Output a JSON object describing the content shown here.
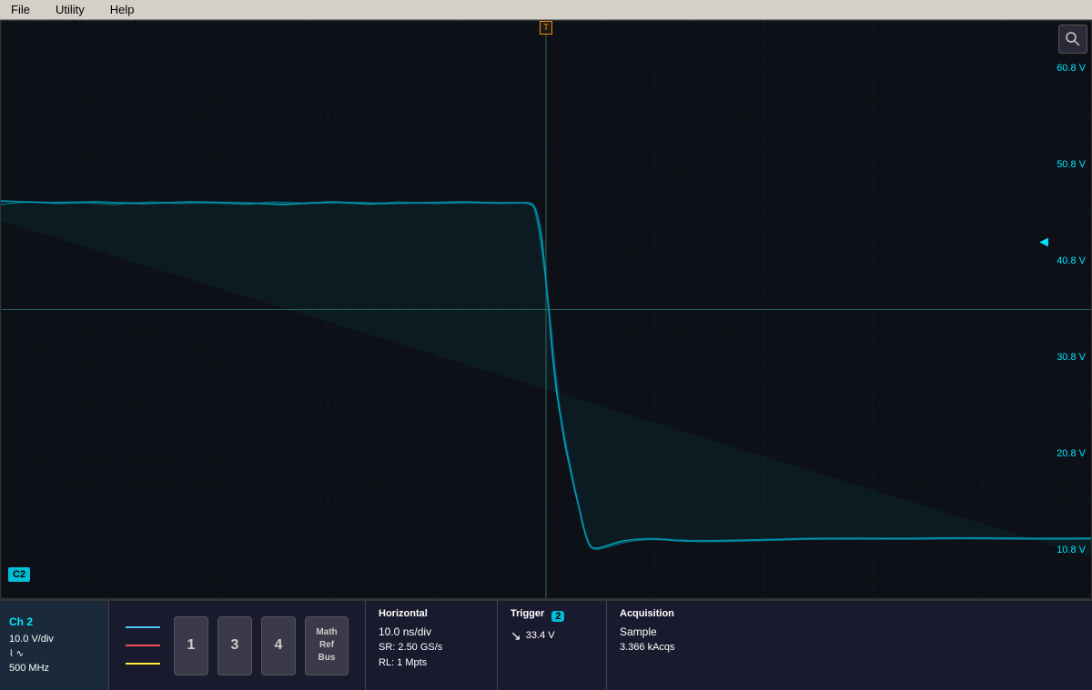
{
  "menubar": {
    "items": [
      "File",
      "Utility",
      "Help"
    ]
  },
  "yaxis": {
    "labels": [
      "60.8 V",
      "50.8 V",
      "40.8 V",
      "30.8 V",
      "20.8 V",
      "10.8 V"
    ]
  },
  "channel": {
    "ch2_label": "C2",
    "ch2_title": "Ch 2",
    "ch2_vdiv": "10.0 V/div",
    "ch2_bw": "500 MHz",
    "ch2_icon": "⌇"
  },
  "channel_buttons": {
    "btn1": "1",
    "btn3": "3",
    "btn4": "4",
    "math_label": "Math\nRef\nBus"
  },
  "waveform_lines": {
    "ch1_color": "#4fc3f7",
    "ch2_color": "#ef5350",
    "ch3_color": "#ffeb3b",
    "ch_inactive": "#555"
  },
  "horizontal": {
    "title": "Horizontal",
    "time_div": "10.0 ns/div",
    "sample_rate": "SR: 2.50 GS/s",
    "record_length": "RL: 1 Mpts"
  },
  "trigger": {
    "title": "Trigger",
    "channel_num": "2",
    "level": "33.4 V",
    "icon": "↘"
  },
  "acquisition": {
    "title": "Acquisition",
    "mode": "Sample",
    "count": "3.366 kAcqs"
  },
  "zoom_icon": "🔍"
}
